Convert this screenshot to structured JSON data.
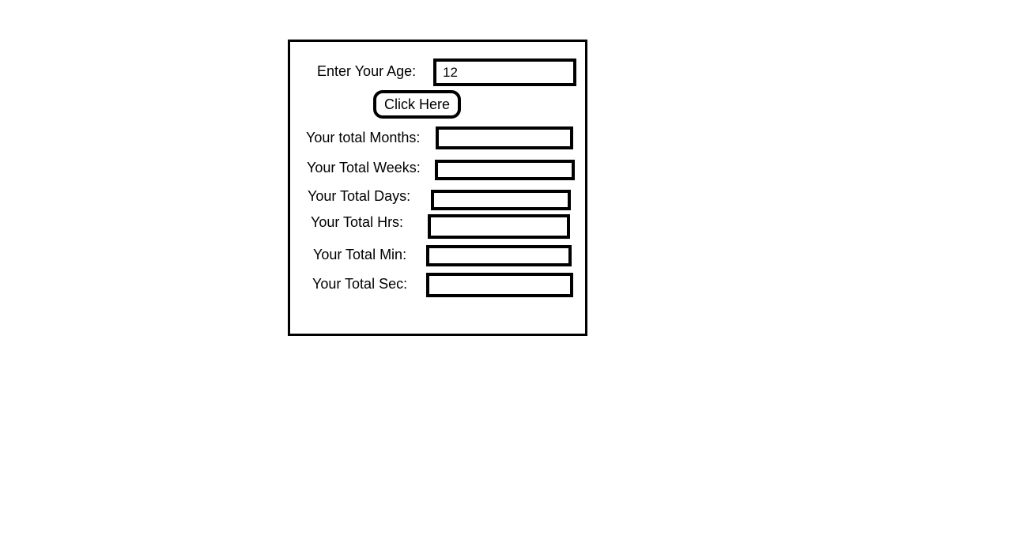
{
  "form": {
    "age_label": "Enter Your Age:",
    "age_value": "12",
    "button_label": "Click Here",
    "months_label": "Your total Months:",
    "months_value": "",
    "weeks_label": "Your Total Weeks:",
    "weeks_value": "",
    "days_label": "Your Total Days:",
    "days_value": "",
    "hours_label": "Your Total Hrs:",
    "hours_value": "",
    "minutes_label": "Your Total Min:",
    "minutes_value": "",
    "seconds_label": "Your Total Sec:",
    "seconds_value": ""
  }
}
